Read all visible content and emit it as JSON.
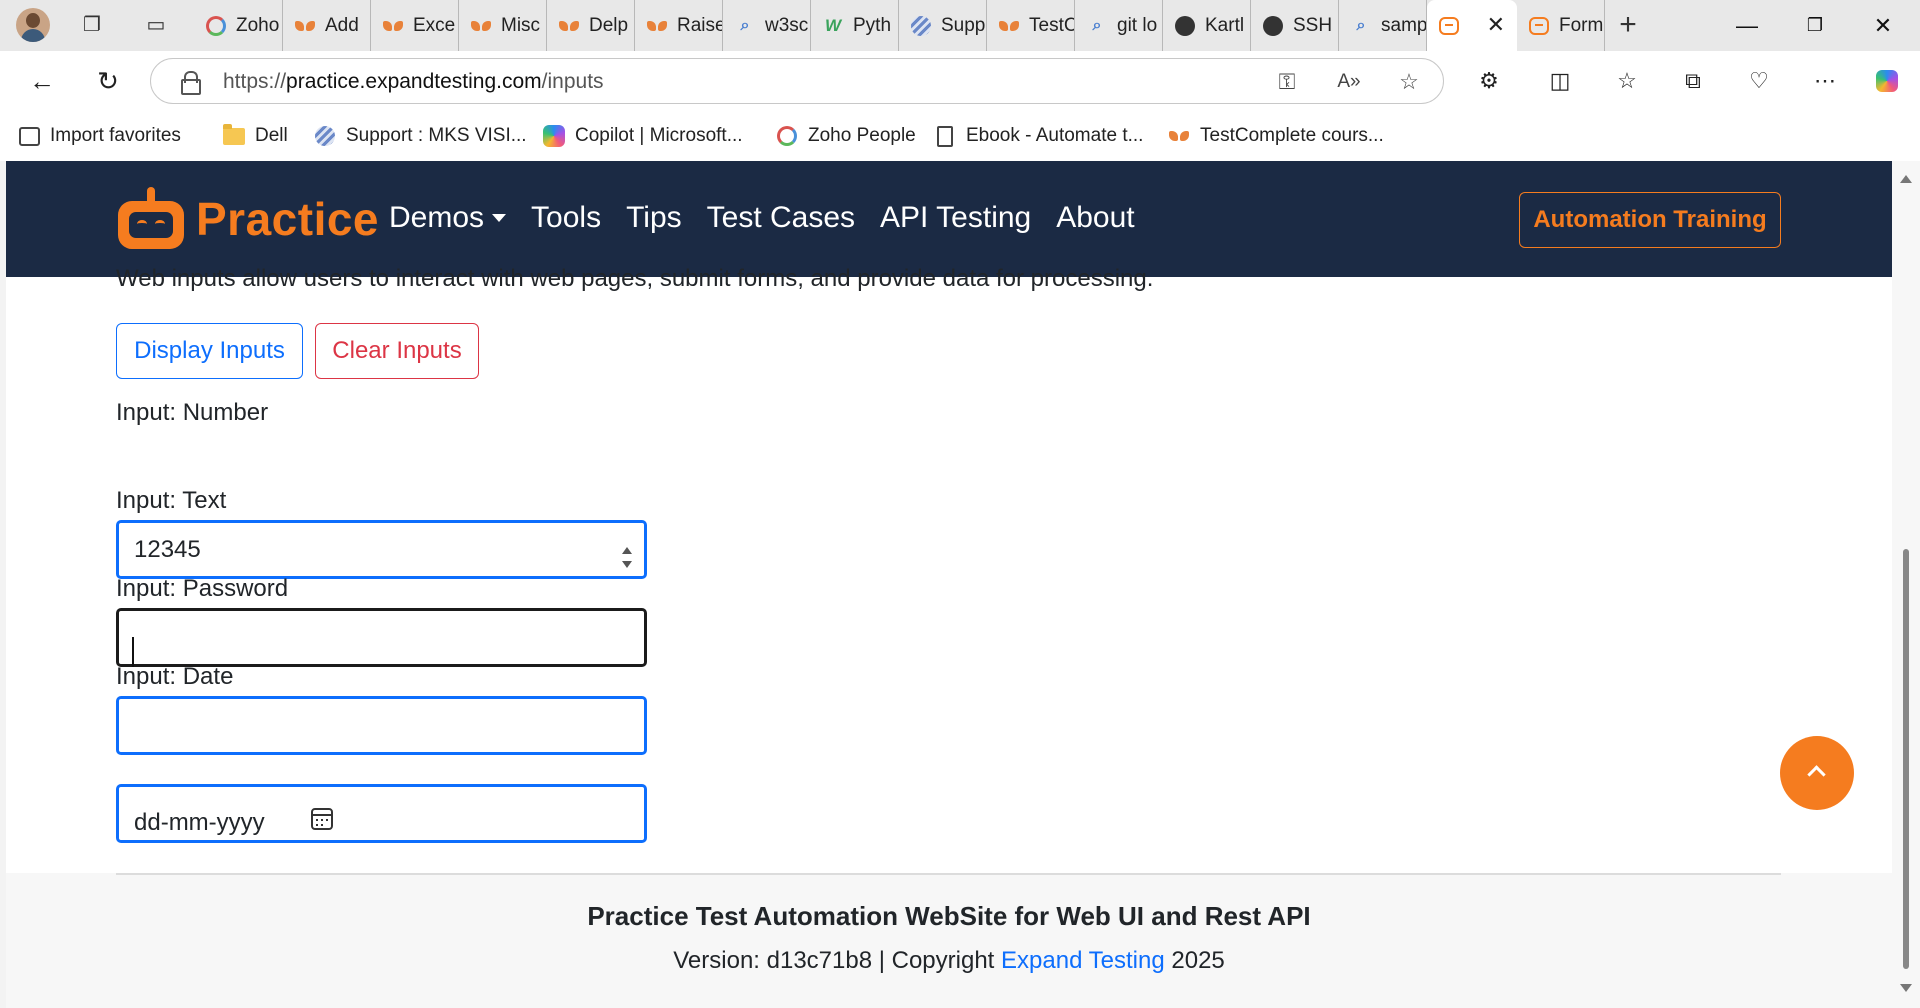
{
  "browser": {
    "tabs": [
      {
        "title": "Zoho",
        "icon": "zoho-icon",
        "width": 89
      },
      {
        "title": "Add",
        "icon": "cat-icon",
        "width": 88
      },
      {
        "title": "Exce",
        "icon": "cat-icon",
        "width": 88
      },
      {
        "title": "Misc",
        "icon": "cat-icon",
        "width": 88
      },
      {
        "title": "Delp",
        "icon": "cat-icon",
        "width": 88
      },
      {
        "title": "Raise",
        "icon": "cat-icon",
        "width": 88
      },
      {
        "title": "w3sc",
        "icon": "search-icon",
        "width": 88
      },
      {
        "title": "Pyth",
        "icon": "w-icon",
        "width": 88
      },
      {
        "title": "Supp",
        "icon": "stripe-icon",
        "width": 88
      },
      {
        "title": "TestC",
        "icon": "cat-icon",
        "width": 88
      },
      {
        "title": "git lo",
        "icon": "search-icon",
        "width": 88
      },
      {
        "title": "Kartl",
        "icon": "github-icon",
        "width": 88
      },
      {
        "title": "SSH",
        "icon": "github-icon",
        "width": 88
      },
      {
        "title": "samp",
        "icon": "search-icon",
        "width": 88
      },
      {
        "title": "",
        "icon": "robot-icon",
        "width": 90,
        "active": true
      },
      {
        "title": "Form",
        "icon": "robot-icon",
        "width": 88
      }
    ],
    "url_scheme": "https://",
    "url_host": "practice.expandtesting.com",
    "url_path": "/inputs",
    "favorites": [
      {
        "label": "Import favorites",
        "icon": "import-icon"
      },
      {
        "label": "Dell",
        "icon": "folder-icon"
      },
      {
        "label": "Support : MKS VISI...",
        "icon": "stripe-icon"
      },
      {
        "label": "Copilot | Microsoft...",
        "icon": "copilot-icon"
      },
      {
        "label": "Zoho People",
        "icon": "zoho-icon"
      },
      {
        "label": "Ebook - Automate t...",
        "icon": "page-icon"
      },
      {
        "label": "TestComplete cours...",
        "icon": "cat-icon"
      }
    ]
  },
  "site": {
    "brand": "Practice",
    "menu": [
      "Demos",
      "Tools",
      "Tips",
      "Test Cases",
      "API Testing",
      "About"
    ],
    "cta": "Automation Training",
    "accent": "#f57c1f",
    "navbar_bg": "#1b2a44"
  },
  "page": {
    "intro": "Web inputs allow users to interact with web pages, submit forms, and provide data for processing.",
    "display_button": "Display Inputs",
    "clear_button": "Clear Inputs",
    "number_label": "Input: Number",
    "number_value": "12345",
    "text_label": "Input: Text",
    "text_value": "",
    "password_label": "Input: Password",
    "password_value": "",
    "date_label": "Input: Date",
    "date_placeholder": "dd-mm-yyyy"
  },
  "footer": {
    "title": "Practice Test Automation WebSite for Web UI and Rest API",
    "version_prefix": "Version: d13c71b8 | Copyright ",
    "link": "Expand Testing",
    "year": " 2025"
  }
}
